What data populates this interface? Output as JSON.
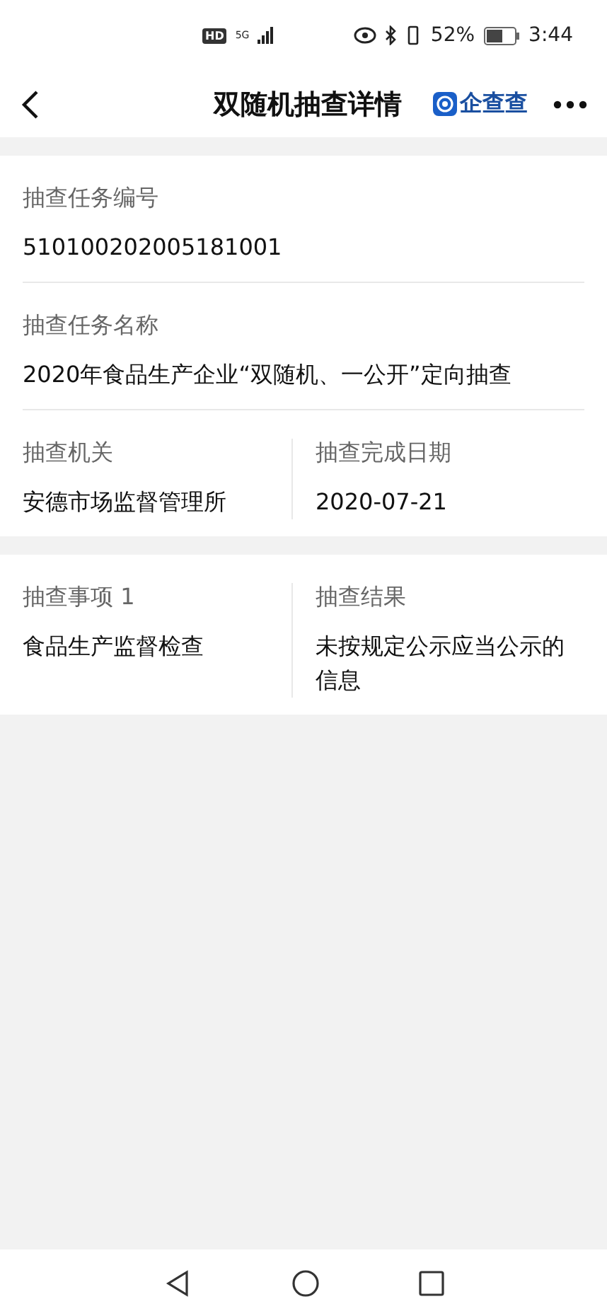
{
  "status_bar": {
    "hd": "HD",
    "network": "5G",
    "battery_percent": "52%",
    "time": "3:44"
  },
  "header": {
    "title": "双随机抽查详情",
    "brand": "企查查"
  },
  "cards": [
    {
      "rows": [
        {
          "fields": [
            {
              "label": "抽查任务编号",
              "value": "510100202005181001"
            }
          ]
        },
        {
          "fields": [
            {
              "label": "抽查任务名称",
              "value": "2020年食品生产企业“双随机、一公开”定向抽查"
            }
          ]
        },
        {
          "fields": [
            {
              "label": "抽查机关",
              "value": "安德市场监督管理所"
            },
            {
              "label": "抽查完成日期",
              "value": "2020-07-21"
            }
          ]
        }
      ]
    },
    {
      "rows": [
        {
          "fields": [
            {
              "label": "抽查事项 1",
              "value": "食品生产监督检查"
            },
            {
              "label": "抽查结果",
              "value": "未按规定公示应当公示的信息"
            }
          ]
        }
      ]
    }
  ]
}
